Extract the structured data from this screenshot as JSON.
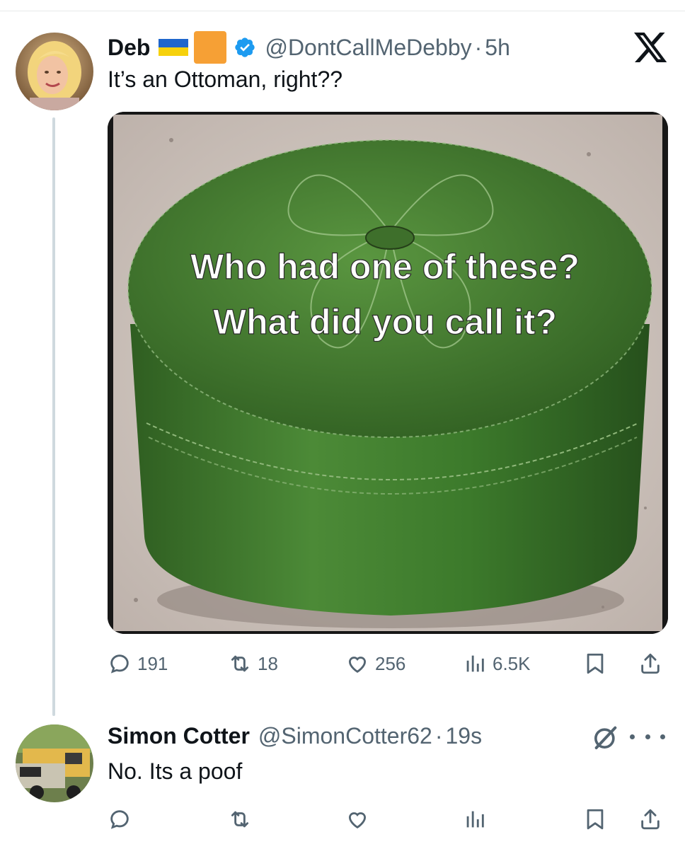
{
  "tweet": {
    "author_name": "Deb",
    "handle": "@DontCallMeDebby",
    "separator": "·",
    "time": "5h",
    "text": "It’s an Ottoman, right??",
    "image_text_line1": "Who had one of these?",
    "image_text_line2": "What did you call it?",
    "stats": {
      "replies": "191",
      "reposts": "18",
      "likes": "256",
      "views": "6.5K"
    }
  },
  "reply": {
    "author_name": "Simon Cotter",
    "handle": "@SimonCotter62",
    "separator": "·",
    "time": "19s",
    "text": "No. Its a poof"
  },
  "icons": {
    "app": "x-logo-icon",
    "verified": "verified-badge-icon",
    "flag": "ukraine-flag-icon",
    "square": "orange-square-icon",
    "reply": "reply-icon",
    "repost": "repost-icon",
    "like": "heart-icon",
    "views": "views-icon",
    "bookmark": "bookmark-icon",
    "share": "share-icon",
    "grok": "grok-icon",
    "more": "more-icon"
  },
  "colors": {
    "text_primary": "#0f1419",
    "text_secondary": "#536471",
    "verified": "#1d9bf0",
    "thread_line": "#cfd9de",
    "ottoman_green": "#3f7a2e"
  }
}
